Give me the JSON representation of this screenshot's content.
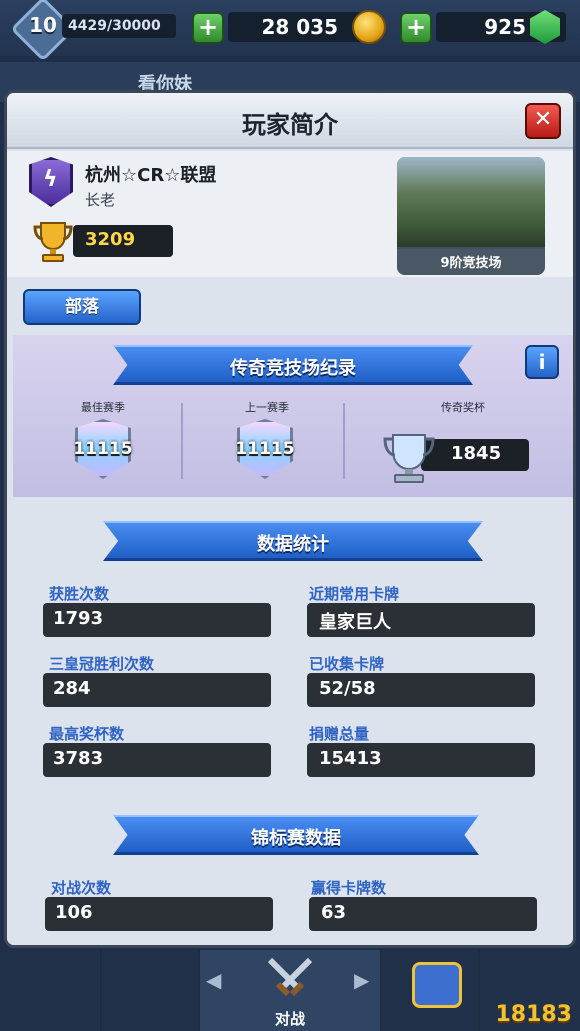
{
  "hud": {
    "level": "10",
    "xp": "4429/30000",
    "gold": "28 035",
    "gems": "925",
    "plus_symbol": "+"
  },
  "background": {
    "clan_peek_text": "看你妹"
  },
  "modal": {
    "title": "玩家简介",
    "close_symbol": "✕"
  },
  "profile": {
    "clan_name": "杭州☆CR☆联盟",
    "role": "长老",
    "trophies": "3209",
    "arena_label": "9阶竞技场"
  },
  "clan_button": {
    "label": "部落"
  },
  "legend": {
    "title": "传奇竞技场纪录",
    "info_symbol": "i",
    "best_season_label": "最佳赛季",
    "best_season_value": "11115",
    "last_season_label": "上一赛季",
    "last_season_value": "11115",
    "legend_trophies_label": "传奇奖杯",
    "legend_trophies_value": "1845"
  },
  "stats": {
    "title": "数据统计",
    "items": [
      {
        "label": "获胜次数",
        "value": "1793"
      },
      {
        "label": "近期常用卡牌",
        "value": "皇家巨人"
      },
      {
        "label": "三皇冠胜利次数",
        "value": "284"
      },
      {
        "label": "已收集卡牌",
        "value": "52/58"
      },
      {
        "label": "最高奖杯数",
        "value": "3783"
      },
      {
        "label": "捐赠总量",
        "value": "15413"
      }
    ]
  },
  "tournament": {
    "title": "锦标赛数据",
    "items": [
      {
        "label": "对战次数",
        "value": "106"
      },
      {
        "label": "赢得卡牌数",
        "value": "63"
      }
    ]
  },
  "bottom_nav": {
    "active_label": "对战",
    "left_arrow": "◀",
    "right_arrow": "▶"
  },
  "watermark": "18183",
  "colors": {
    "accent_blue": "#2f63c4",
    "ribbon_blue": "#1f5fc7",
    "close_red": "#b81c16",
    "trophy_gold": "#ffd84a"
  }
}
